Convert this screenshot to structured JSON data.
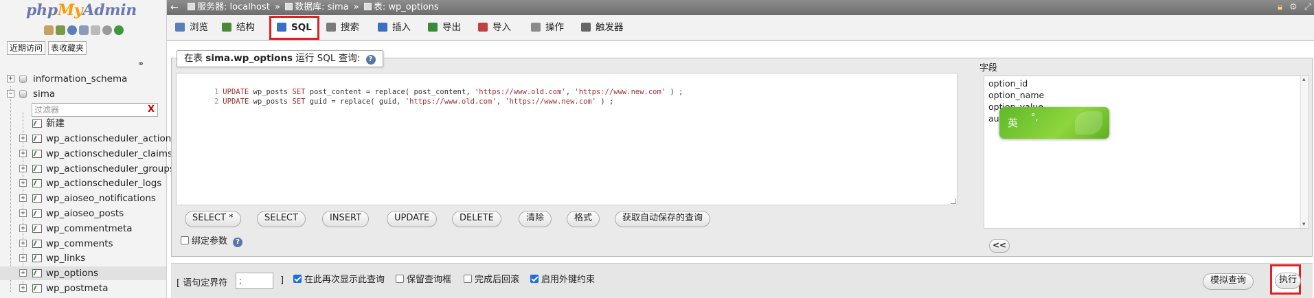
{
  "logo": {
    "php": "php",
    "my": "My",
    "admin": "Admin"
  },
  "nav": {
    "tabs": [
      "近期访问",
      "表收藏夹"
    ],
    "tree": [
      {
        "label": "information_schema"
      },
      {
        "label": "sima"
      }
    ],
    "filter_placeholder": "过滤器",
    "filter_clear": "X",
    "new_label": "新建",
    "tables": [
      "wp_actionscheduler_actions",
      "wp_actionscheduler_claims",
      "wp_actionscheduler_groups",
      "wp_actionscheduler_logs",
      "wp_aioseo_notifications",
      "wp_aioseo_posts",
      "wp_commentmeta",
      "wp_comments",
      "wp_links",
      "wp_options",
      "wp_postmeta"
    ],
    "selected_table": "wp_options"
  },
  "breadcrumb": {
    "server": "服务器: localhost",
    "database": "数据库: sima",
    "table": "表: wp_options",
    "sep": "»"
  },
  "tabs": [
    {
      "label": "浏览",
      "icon": "browse-icon",
      "color": "#5a7fb5"
    },
    {
      "label": "结构",
      "icon": "structure-icon",
      "color": "#4b8a3c"
    },
    {
      "label": "SQL",
      "icon": "sql-icon",
      "color": "#3a6fc4",
      "active": true
    },
    {
      "label": "搜索",
      "icon": "search-icon",
      "color": "#7a7a7a"
    },
    {
      "label": "插入",
      "icon": "insert-icon",
      "color": "#3a6fc4"
    },
    {
      "label": "导出",
      "icon": "export-icon",
      "color": "#3a8a3a"
    },
    {
      "label": "导入",
      "icon": "import-icon",
      "color": "#c04040"
    },
    {
      "label": "操作",
      "icon": "wrench-icon",
      "color": "#8a8a8a"
    },
    {
      "label": "触发器",
      "icon": "triggers-icon",
      "color": "#666666"
    }
  ],
  "sql": {
    "legend_prefix": "在表",
    "legend_table": "sima.wp_options",
    "legend_suffix": "运行 SQL 查询:",
    "lines": [
      {
        "num": "1",
        "kw1": "UPDATE",
        "t1": " wp_posts ",
        "kw2": "SET",
        "t2": " post_content = replace( post_content, ",
        "s1": "'https://www.old.com'",
        "t3": ", ",
        "s2": "'https://www.new.com'",
        "t4": " ) ;"
      },
      {
        "num": "2",
        "kw1": "UPDATE",
        "t1": " wp_posts ",
        "kw2": "SET",
        "t2": " guid = replace( guid, ",
        "s1": "'https://www.old.com'",
        "t3": ", ",
        "s2": "'https://www.new.com'",
        "t4": " ) ;"
      }
    ],
    "buttons": [
      "SELECT *",
      "SELECT",
      "INSERT",
      "UPDATE",
      "DELETE",
      "清除",
      "格式",
      "获取自动保存的查询"
    ],
    "bind_params": "绑定参数"
  },
  "fields": {
    "label": "字段",
    "items": [
      "option_id",
      "option_name",
      "option_value",
      "autoload"
    ],
    "insert_button": "<<"
  },
  "ime": {
    "text": "英",
    "punct": "°,"
  },
  "bottom": {
    "delimiter_label": "[ 语句定界符",
    "delimiter_value": ";",
    "delimiter_close": "]",
    "options": [
      {
        "label": "在此再次显示此查询",
        "checked": true
      },
      {
        "label": "保留查询框",
        "checked": false
      },
      {
        "label": "完成后回滚",
        "checked": false
      },
      {
        "label": "启用外键约束",
        "checked": true
      }
    ],
    "simulate_button": "模拟查询",
    "go_button": "执行"
  },
  "colors": {
    "highlight": "#e02020",
    "logo_blue": "#6c78af",
    "logo_orange": "#ff9900",
    "ime_green": "#6fc22e"
  }
}
